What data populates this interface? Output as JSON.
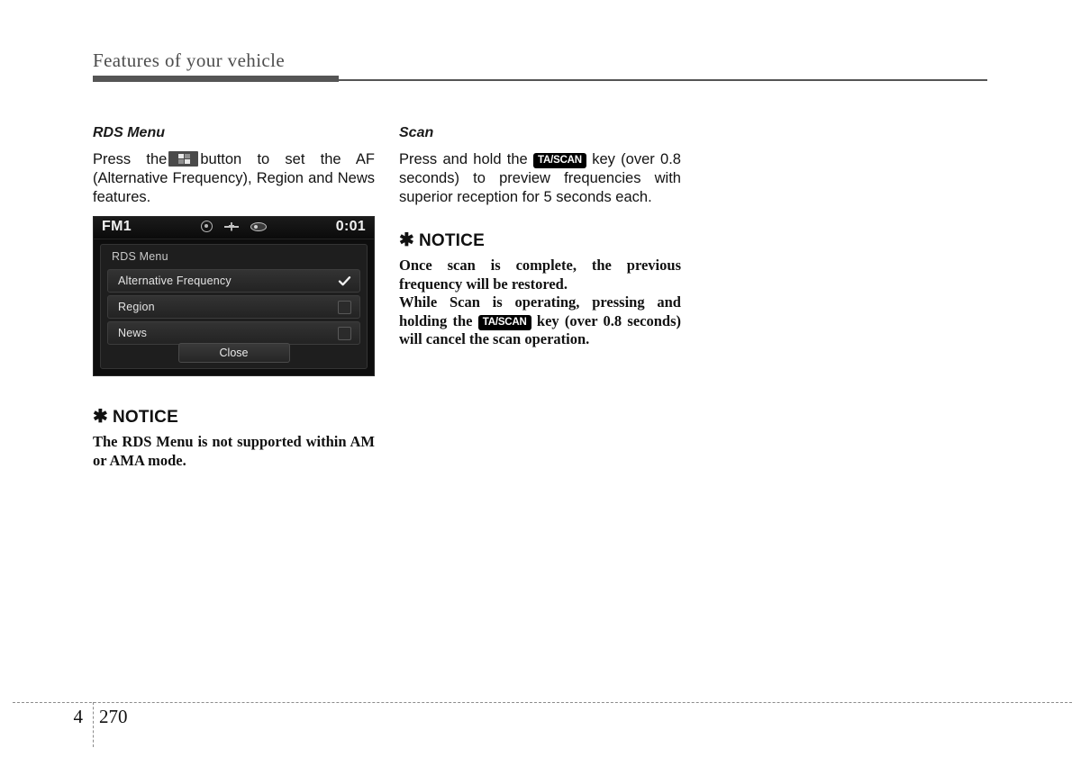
{
  "header": {
    "title": "Features of your vehicle"
  },
  "left_column": {
    "section_title": "RDS Menu",
    "paragraph_before_icon": "Press the",
    "button_icon": "grid-2x2-button-icon",
    "paragraph_after_icon": "button to set the AF (Alternative Frequency), Region and News features.",
    "notice": {
      "symbol": "✱",
      "heading": "NOTICE",
      "body": "The RDS Menu is not supported within AM or AMA mode."
    }
  },
  "right_column": {
    "section_title": "Scan",
    "paragraph_part1": "Press and hold the",
    "key_badge": "TA/SCAN",
    "paragraph_part2": "key (over 0.8 seconds) to preview frequencies with superior reception for 5 seconds each.",
    "notice": {
      "symbol": "✱",
      "heading": "NOTICE",
      "line1": "Once scan is complete, the previous frequency will be restored.",
      "line2_part1": "While Scan is operating, pressing and holding the",
      "line2_badge": "TA/SCAN",
      "line2_part2": "key (over 0.8 seconds) will cancel the scan operation."
    }
  },
  "head_unit": {
    "band": "FM1",
    "clock": "0:01",
    "status_icons": [
      "disc-icon",
      "usb-icon",
      "key-fob-icon"
    ],
    "panel_title": "RDS Menu",
    "rows": [
      {
        "label": "Alternative Frequency",
        "checked": true
      },
      {
        "label": "Region",
        "checked": false
      },
      {
        "label": "News",
        "checked": false
      }
    ],
    "close_label": "Close"
  },
  "footer": {
    "chapter": "4",
    "page_number": "270"
  },
  "colors": {
    "header_rule": "#555555",
    "body_text": "#131313",
    "display_bg": "#0d0d0d",
    "badge_bg": "#000000"
  }
}
